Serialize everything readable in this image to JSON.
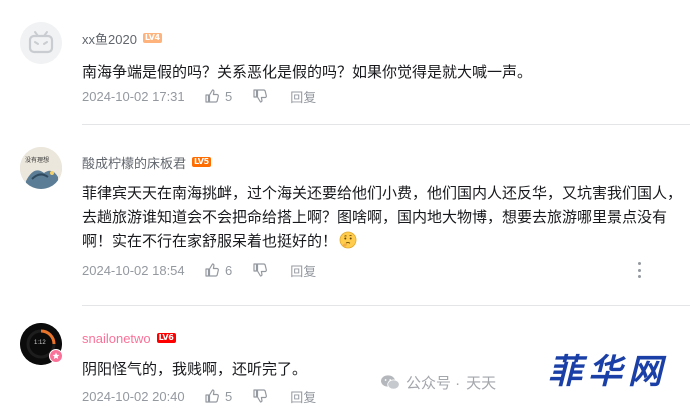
{
  "comments": [
    {
      "username": "xx鱼2020",
      "level": "LV4",
      "text": "南海争端是假的吗？关系恶化是假的吗？如果你觉得是就大喊一声。",
      "time": "2024-10-02 17:31",
      "likes": "5",
      "reply_label": "回复",
      "avatar_icon": "tv-mascot-icon"
    },
    {
      "username": "酸成柠檬的床板君",
      "level": "LV5",
      "text": "菲律宾天天在南海挑衅，过个海关还要给他们小费，他们国内人还反华，又坑害我们国人，去趟旅游谁知道会不会把命给搭上啊？图啥啊，国内地大物博，想要去旅游哪里景点没有啊！实在不行在家舒服呆着也挺好的！",
      "emoji": "thinking-face-emoji",
      "avatar_text": "没有理想",
      "time": "2024-10-02 18:54",
      "likes": "6",
      "reply_label": "回复"
    },
    {
      "username": "snailonetwo",
      "level": "LV6",
      "text": "阴阳怪气的，我贱啊，还听完了。",
      "avatar_text": "1:12",
      "time": "2024-10-02 20:40",
      "likes": "5",
      "reply_label": "回复"
    }
  ],
  "watermark": {
    "prefix": "公众号 ·",
    "name": "天天",
    "brand": "菲华网"
  },
  "colors": {
    "accent_pink": "#fb7299",
    "meta_gray": "#9499a0",
    "brand_blue": "#1a3fa6"
  }
}
